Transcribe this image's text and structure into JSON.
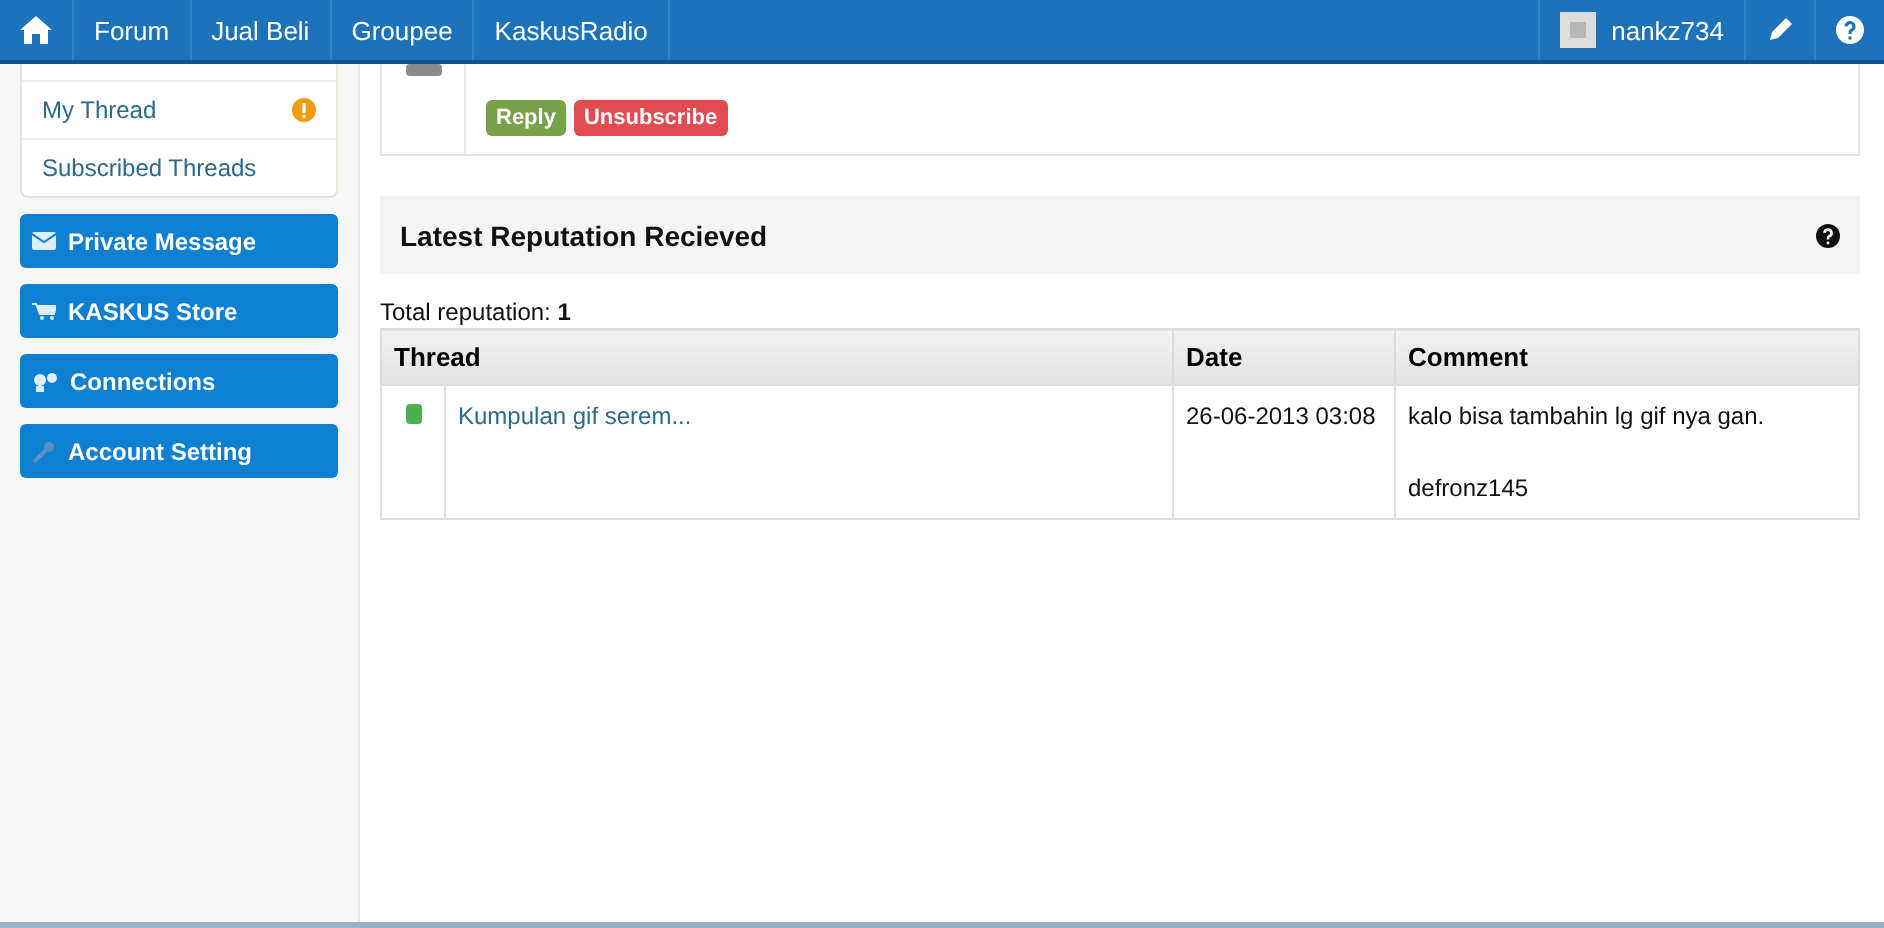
{
  "navbar": {
    "links": [
      {
        "label": "Forum"
      },
      {
        "label": "Jual Beli"
      },
      {
        "label": "Groupee"
      },
      {
        "label": "KaskusRadio"
      }
    ],
    "user": {
      "name": "nankz734"
    }
  },
  "sidebar": {
    "items": [
      {
        "label": "My Thread",
        "notification": true
      },
      {
        "label": "Subscribed Threads",
        "notification": false
      }
    ],
    "buttons": [
      {
        "label": "Private Message",
        "kind": "mail"
      },
      {
        "label": "KASKUS Store",
        "kind": "cart"
      },
      {
        "label": "Connections",
        "kind": "people"
      },
      {
        "label": "Account Setting",
        "kind": "wrench"
      }
    ]
  },
  "post": {
    "actions": [
      {
        "label": "Reply",
        "kind": "reply"
      },
      {
        "label": "Unsubscribe",
        "kind": "unsubscribe"
      }
    ]
  },
  "reputation": {
    "title": "Latest Reputation Recieved",
    "total_label": "Total reputation:",
    "total": "1",
    "table": {
      "columns": [
        "Thread",
        "Date",
        "Comment"
      ],
      "rows": [
        {
          "color": "#4caf50",
          "thread": "Kumpulan gif serem...",
          "date": "26-06-2013 03:08",
          "comment": "kalo bisa tambahin lg gif nya gan.",
          "from": "defronz145"
        }
      ]
    }
  }
}
